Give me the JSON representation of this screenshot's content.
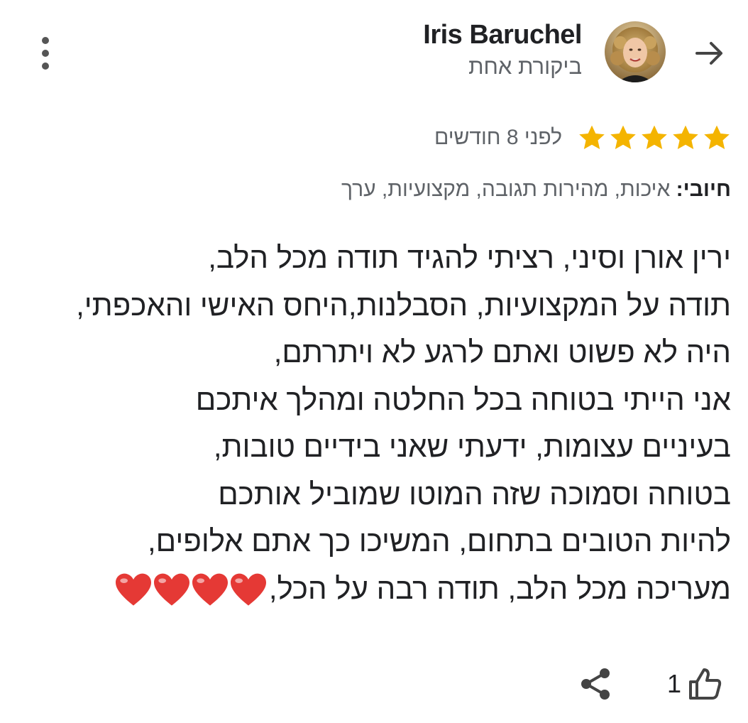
{
  "header": {
    "back_icon": "arrow-forward-icon",
    "menu_icon": "more-vert-icon",
    "avatar_icon": "profile-photo"
  },
  "reviewer": {
    "name": "Iris Baruchel",
    "subtitle": "ביקורת אחת"
  },
  "rating": {
    "stars": 5,
    "max_stars": 5,
    "star_color": "#F4B400",
    "time_ago": "לפני 8 חודשים"
  },
  "positives": {
    "label": "חיובי:",
    "values": "איכות, מהירות תגובה, מקצועיות, ערך"
  },
  "review": {
    "lines": [
      "ירין אורן וסיני, רציתי להגיד תודה מכל הלב,",
      "תודה על המקצועיות, הסבלנות,היחס האישי והאכפתי,",
      "היה לא פשוט ואתם לרגע לא ויתרתם,",
      "אני הייתי בטוחה בכל החלטה ומהלך איתכם",
      "בעיניים עצומות, ידעתי שאני בידיים טובות,",
      "בטוחה וסמוכה שזה המוטו שמוביל אותכם",
      "להיות הטובים בתחום, המשיכו כך אתם אלופים,",
      "מעריכה מכל הלב, תודה רבה על הכל,"
    ],
    "heart_count": 4,
    "heart_icon": "red-heart-emoji",
    "heart_color": "#E53935"
  },
  "footer": {
    "like_count": "1",
    "like_icon": "thumb-up-icon",
    "share_icon": "share-icon"
  },
  "colors": {
    "text_primary": "#202124",
    "text_secondary": "#5f6368"
  }
}
